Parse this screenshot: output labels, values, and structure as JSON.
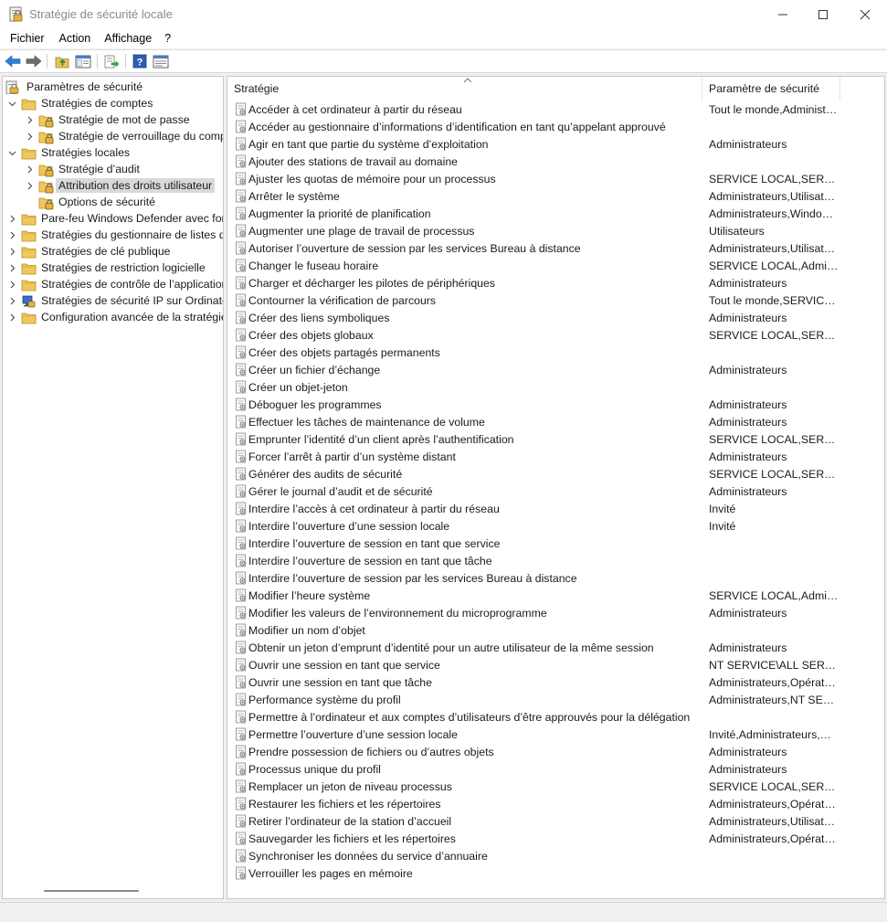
{
  "window": {
    "title": "Stratégie de sécurité locale"
  },
  "menu": {
    "items": [
      "Fichier",
      "Action",
      "Affichage",
      "?"
    ]
  },
  "toolbar": {
    "icons": [
      "back-arrow-icon",
      "forward-arrow-icon",
      "up-folder-icon",
      "show-hide-tree-icon",
      "export-list-icon",
      "help-icon",
      "properties-icon"
    ]
  },
  "tree": {
    "root": "Paramètres de sécurité",
    "items": [
      {
        "label": "Stratégies de comptes",
        "level": 1,
        "expanded": true,
        "icon": "folder-icon"
      },
      {
        "label": "Stratégie de mot de passe",
        "level": 2,
        "expanded": false,
        "icon": "folder-lock-icon"
      },
      {
        "label": "Stratégie de verrouillage du compte",
        "level": 2,
        "expanded": false,
        "icon": "folder-lock-icon"
      },
      {
        "label": "Stratégies locales",
        "level": 1,
        "expanded": true,
        "icon": "folder-icon"
      },
      {
        "label": "Stratégie d’audit",
        "level": 2,
        "expanded": false,
        "icon": "folder-lock-icon"
      },
      {
        "label": "Attribution des droits utilisateur",
        "level": 2,
        "expanded": false,
        "icon": "folder-lock-icon",
        "selected": true
      },
      {
        "label": "Options de sécurité",
        "level": 2,
        "expanded": false,
        "icon": "folder-lock-icon",
        "noexp": true
      },
      {
        "label": "Pare-feu Windows Defender avec fonctions avancées de sécurité",
        "level": 1,
        "expanded": false,
        "icon": "folder-icon"
      },
      {
        "label": "Stratégies du gestionnaire de listes de réseaux",
        "level": 1,
        "expanded": false,
        "icon": "folder-icon",
        "noexp": true
      },
      {
        "label": "Stratégies de clé publique",
        "level": 1,
        "expanded": false,
        "icon": "folder-icon"
      },
      {
        "label": "Stratégies de restriction logicielle",
        "level": 1,
        "expanded": false,
        "icon": "folder-icon"
      },
      {
        "label": "Stratégies de contrôle de l’application",
        "level": 1,
        "expanded": false,
        "icon": "folder-icon"
      },
      {
        "label": "Stratégies de sécurité IP sur Ordinateur local",
        "level": 1,
        "expanded": false,
        "icon": "ip-security-icon"
      },
      {
        "label": "Configuration avancée de la stratégie d’audit",
        "level": 1,
        "expanded": false,
        "icon": "folder-icon"
      }
    ]
  },
  "list": {
    "columns": [
      "Stratégie",
      "Paramètre de sécurité"
    ],
    "rows": [
      {
        "name": "Accéder à cet ordinateur à partir du réseau",
        "value": "Tout le monde,Administrateurs,Utilisateurs,Opérateurs de sauvegarde"
      },
      {
        "name": "Accéder au gestionnaire d’informations d’identification en tant qu’appelant approuvé",
        "value": ""
      },
      {
        "name": "Agir en tant que partie du système d’exploitation",
        "value": "Administrateurs"
      },
      {
        "name": "Ajouter des stations de travail au domaine",
        "value": ""
      },
      {
        "name": "Ajuster les quotas de mémoire pour un processus",
        "value": "SERVICE LOCAL,SERVICE RÉSEAU,Administrateurs"
      },
      {
        "name": "Arrêter le système",
        "value": "Administrateurs,Utilisateurs,Opérateurs de sauvegarde"
      },
      {
        "name": "Augmenter la priorité de planification",
        "value": "Administrateurs,Window Manager\\Window Manager Group"
      },
      {
        "name": "Augmenter une plage de travail de processus",
        "value": "Utilisateurs"
      },
      {
        "name": "Autoriser l’ouverture de session par les services Bureau à distance",
        "value": "Administrateurs,Utilisateurs du Bureau à distance"
      },
      {
        "name": "Changer le fuseau horaire",
        "value": "SERVICE LOCAL,Administrateurs,Utilisateurs"
      },
      {
        "name": "Charger et décharger les pilotes de périphériques",
        "value": "Administrateurs"
      },
      {
        "name": "Contourner la vérification de parcours",
        "value": "Tout le monde,SERVICE LOCAL,SERVICE RÉSEAU"
      },
      {
        "name": "Créer des liens symboliques",
        "value": "Administrateurs"
      },
      {
        "name": "Créer des objets globaux",
        "value": "SERVICE LOCAL,SERVICE RÉSEAU,Administrateurs"
      },
      {
        "name": "Créer des objets partagés permanents",
        "value": ""
      },
      {
        "name": "Créer un fichier d’échange",
        "value": "Administrateurs"
      },
      {
        "name": "Créer un objet-jeton",
        "value": ""
      },
      {
        "name": "Déboguer les programmes",
        "value": "Administrateurs"
      },
      {
        "name": "Effectuer les tâches de maintenance de volume",
        "value": "Administrateurs"
      },
      {
        "name": "Emprunter l’identité d’un client après l’authentification",
        "value": "SERVICE LOCAL,SERVICE RÉSEAU,Administrateurs"
      },
      {
        "name": "Forcer l’arrêt à partir d’un système distant",
        "value": "Administrateurs"
      },
      {
        "name": "Générer des audits de sécurité",
        "value": "SERVICE LOCAL,SERVICE RÉSEAU"
      },
      {
        "name": "Gérer le journal d’audit et de sécurité",
        "value": "Administrateurs"
      },
      {
        "name": "Interdire l’accès à cet ordinateur à partir du réseau",
        "value": "Invité"
      },
      {
        "name": "Interdire l’ouverture d’une session locale",
        "value": "Invité"
      },
      {
        "name": "Interdire l’ouverture de session en tant que service",
        "value": ""
      },
      {
        "name": "Interdire l’ouverture de session en tant que tâche",
        "value": ""
      },
      {
        "name": "Interdire l’ouverture de session par les services Bureau à distance",
        "value": ""
      },
      {
        "name": "Modifier l’heure système",
        "value": "SERVICE LOCAL,Administrateurs"
      },
      {
        "name": "Modifier les valeurs de l’environnement du microprogramme",
        "value": "Administrateurs"
      },
      {
        "name": "Modifier un nom d’objet",
        "value": ""
      },
      {
        "name": "Obtenir un jeton d’emprunt d’identité pour un autre utilisateur de la même session",
        "value": "Administrateurs"
      },
      {
        "name": "Ouvrir une session en tant que service",
        "value": "NT SERVICE\\ALL SERVICES"
      },
      {
        "name": "Ouvrir une session en tant que tâche",
        "value": "Administrateurs,Opérateurs de sauvegarde,Utilisateurs du journal de performances"
      },
      {
        "name": "Performance système du profil",
        "value": "Administrateurs,NT SERVICE\\WdiServiceHost"
      },
      {
        "name": "Permettre à l’ordinateur et aux comptes d’utilisateurs d’être approuvés pour la délégation",
        "value": ""
      },
      {
        "name": "Permettre l’ouverture d’une session locale",
        "value": "Invité,Administrateurs,Utilisateurs,Opérateurs de sauvegarde"
      },
      {
        "name": "Prendre possession de fichiers ou d’autres objets",
        "value": "Administrateurs"
      },
      {
        "name": "Processus unique du profil",
        "value": "Administrateurs"
      },
      {
        "name": "Remplacer un jeton de niveau processus",
        "value": "SERVICE LOCAL,SERVICE RÉSEAU"
      },
      {
        "name": "Restaurer les fichiers et les répertoires",
        "value": "Administrateurs,Opérateurs de sauvegarde"
      },
      {
        "name": "Retirer l’ordinateur de la station d’accueil",
        "value": "Administrateurs,Utilisateurs"
      },
      {
        "name": "Sauvegarder les fichiers et les répertoires",
        "value": "Administrateurs,Opérateurs de sauvegarde"
      },
      {
        "name": "Synchroniser les données du service d’annuaire",
        "value": ""
      },
      {
        "name": "Verrouiller les pages en mémoire",
        "value": ""
      }
    ]
  }
}
